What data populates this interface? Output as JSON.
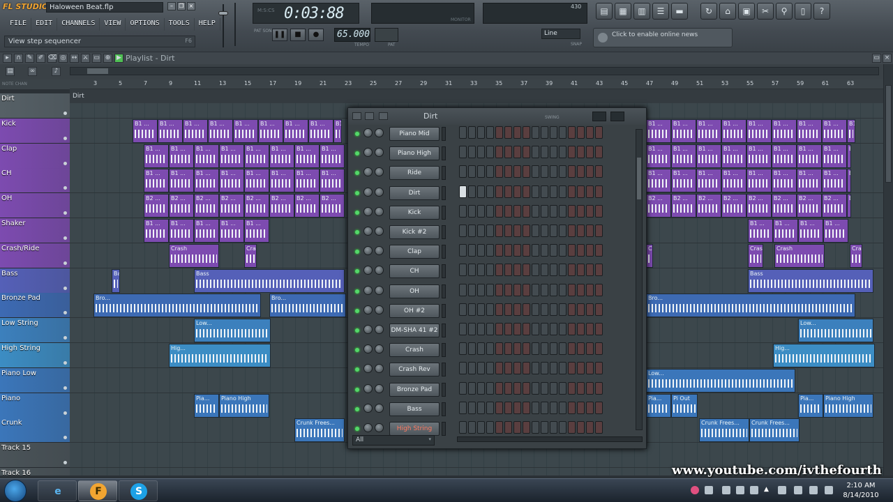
{
  "app": {
    "logo": "FL STUDIO",
    "filename": "Haloween Beat.flp",
    "menu": [
      "FILE",
      "EDIT",
      "CHANNELS",
      "VIEW",
      "OPTIONS",
      "TOOLS",
      "HELP"
    ],
    "hint": "View step sequencer",
    "hint_key": "F6",
    "time": "0:03:88",
    "time_unit_label": "M:S:CS",
    "tempo": "65.000",
    "tempo_label": "TEMPO",
    "pattern_label": "PAT",
    "pat_song_label": "PAT SONG",
    "monitor_label": "MONITOR",
    "meter_value": "430",
    "snap_value": "Line",
    "snap_label": "SNAP",
    "news_text": "Click to enable online news",
    "playlist_title": "Playlist - Dirt",
    "ruler_left_label": "NOTE CHAN",
    "marker_label": "Dirt",
    "accent_orange": "#f2a531",
    "accent_led": "#54d86a"
  },
  "ruler_ticks": [
    "3",
    "5",
    "7",
    "9",
    "11",
    "13",
    "15",
    "17",
    "19",
    "21",
    "23",
    "25",
    "27",
    "29",
    "31",
    "33",
    "35",
    "37",
    "39",
    "41",
    "43",
    "45",
    "47",
    "49",
    "51",
    "53",
    "55",
    "57",
    "59",
    "61",
    "63"
  ],
  "tracks": [
    {
      "name": "Dirt",
      "color": "#566066"
    },
    {
      "name": "Kick",
      "color": "#7d4bb0"
    },
    {
      "name": "Clap",
      "color": "#7d4bb0"
    },
    {
      "name": "CH",
      "color": "#7d4bb0"
    },
    {
      "name": "OH",
      "color": "#7d4bb0"
    },
    {
      "name": "Shaker",
      "color": "#7d4bb0"
    },
    {
      "name": "Crash/Ride",
      "color": "#7d4bb0"
    },
    {
      "name": "Bass",
      "color": "#5560b8"
    },
    {
      "name": "Bronze Pad",
      "color": "#3d6ab3"
    },
    {
      "name": "Low String",
      "color": "#3c80bd"
    },
    {
      "name": "High String",
      "color": "#3c8dc4"
    },
    {
      "name": "Piano Low",
      "color": "#3b76ba"
    },
    {
      "name": "Piano",
      "color": "#3b76ba"
    },
    {
      "name": "Crunk",
      "color": "#3b76ba"
    },
    {
      "name": "Track 15",
      "color": "#4a5358"
    },
    {
      "name": "Track 16",
      "color": "#4a5358"
    }
  ],
  "clip_labels": {
    "kick": "B1 ...",
    "kick2": "B2 ...",
    "crash": "Crash",
    "bass": "Bass",
    "bronze": "Bro...",
    "low_string": "Low...",
    "high_string": "Hig...",
    "piano": "Pia...",
    "piano_high": "Piano High",
    "pi_out": "Pi Out",
    "crunk": "Crunk Frees..."
  },
  "step_sequencer": {
    "title": "Dirt",
    "swing_label": "SWING",
    "filter": "All",
    "channels": [
      {
        "name": "Piano Mid"
      },
      {
        "name": "Piano High"
      },
      {
        "name": "Ride"
      },
      {
        "name": "Dirt"
      },
      {
        "name": "Kick"
      },
      {
        "name": "Kick #2"
      },
      {
        "name": "Clap"
      },
      {
        "name": "CH"
      },
      {
        "name": "OH"
      },
      {
        "name": "OH #2"
      },
      {
        "name": "DM-SHA 41 #2"
      },
      {
        "name": "Crash"
      },
      {
        "name": "Crash Rev"
      },
      {
        "name": "Bronze Pad"
      },
      {
        "name": "Bass"
      },
      {
        "name": "High String"
      }
    ]
  },
  "taskbar": {
    "time": "2:10 AM",
    "date": "8/14/2010",
    "watermark": "www.youtube.com/ivthefourth"
  }
}
